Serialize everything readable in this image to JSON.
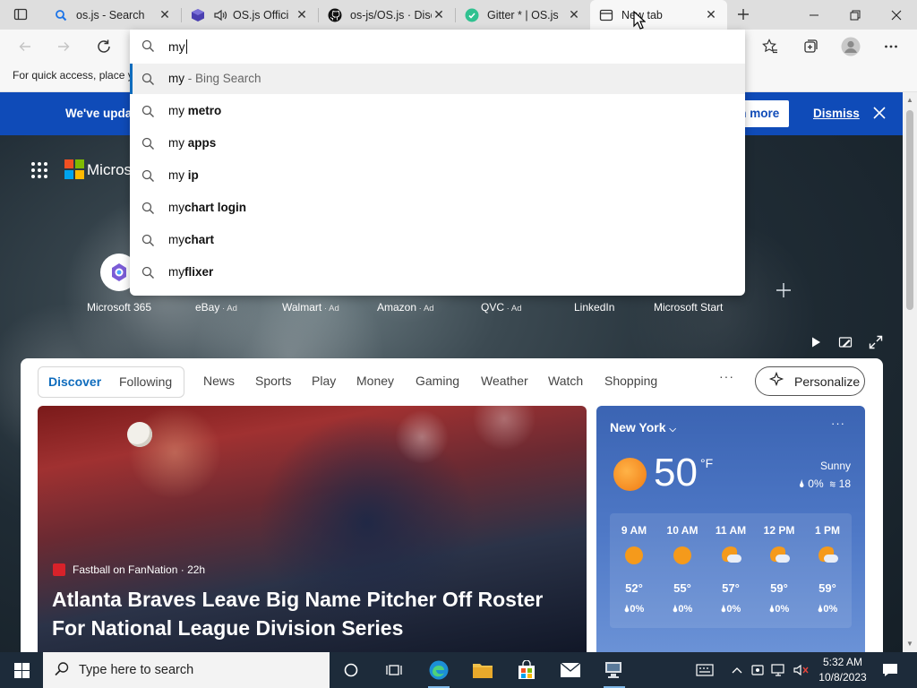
{
  "tabs": [
    {
      "title": "os.js - Search",
      "icon": "search-icon"
    },
    {
      "title": "OS.js Offici",
      "icon": "cube-icon"
    },
    {
      "title": "os-js/OS.js · Disc",
      "icon": "github-icon"
    },
    {
      "title": "Gitter * | OS.js",
      "icon": "gitter-icon"
    },
    {
      "title": "New tab",
      "icon": "newtab-icon",
      "active": true
    }
  ],
  "address": {
    "value": "my"
  },
  "favorites_bar": {
    "text": "For quick access, place y"
  },
  "suggestions": [
    {
      "prefix": "my",
      "bold": "",
      "hint": " - Bing Search",
      "selected": true
    },
    {
      "prefix": "my ",
      "bold": "metro"
    },
    {
      "prefix": "my ",
      "bold": "apps"
    },
    {
      "prefix": "my ",
      "bold": "ip"
    },
    {
      "prefix": "my",
      "bold": "chart login"
    },
    {
      "prefix": "my",
      "bold": "chart"
    },
    {
      "prefix": "my",
      "bold": "flixer"
    }
  ],
  "banner": {
    "text": "We've upda",
    "learn_more": "rn more",
    "dismiss": "Dismiss"
  },
  "brand": {
    "text": "Micros"
  },
  "quick_links": [
    {
      "label": "Microsoft 365",
      "ad": ""
    },
    {
      "label": "eBay",
      "ad": " · Ad"
    },
    {
      "label": "Walmart",
      "ad": " · Ad"
    },
    {
      "label": "Amazon",
      "ad": " · Ad"
    },
    {
      "label": "QVC",
      "ad": " · Ad"
    },
    {
      "label": "LinkedIn",
      "ad": ""
    },
    {
      "label": "Microsoft Start",
      "ad": ""
    }
  ],
  "feed": {
    "pills": [
      "Discover",
      "Following"
    ],
    "nav": [
      "News",
      "Sports",
      "Play",
      "Money",
      "Gaming",
      "Weather",
      "Watch",
      "Shopping"
    ],
    "more": "···",
    "personalize": "Personalize"
  },
  "hero": {
    "source": "Fastball on FanNation · 22h",
    "headline": "Atlanta Braves Leave Big Name Pitcher Off Roster For National League Division Series"
  },
  "weather": {
    "city": "New York",
    "temp": "50",
    "unit": "°F",
    "condition": "Sunny",
    "precip": "0%",
    "wind": "18",
    "more": "···",
    "hourly": [
      {
        "hour": "9 AM",
        "temp": "52°",
        "precip": "0%",
        "icon": "sun-icon"
      },
      {
        "hour": "10 AM",
        "temp": "55°",
        "precip": "0%",
        "icon": "sun-icon"
      },
      {
        "hour": "11 AM",
        "temp": "57°",
        "precip": "0%",
        "icon": "partly-cloudy-icon"
      },
      {
        "hour": "12 PM",
        "temp": "59°",
        "precip": "0%",
        "icon": "partly-cloudy-icon"
      },
      {
        "hour": "1 PM",
        "temp": "59°",
        "precip": "0%",
        "icon": "partly-cloudy-icon"
      }
    ]
  },
  "taskbar": {
    "search_placeholder": "Type here to search",
    "time": "5:32 AM",
    "date": "10/8/2023"
  },
  "colors": {
    "accent": "#0f6cbd",
    "banner": "#0f4bb8",
    "taskbar": "#1d2b3a"
  }
}
